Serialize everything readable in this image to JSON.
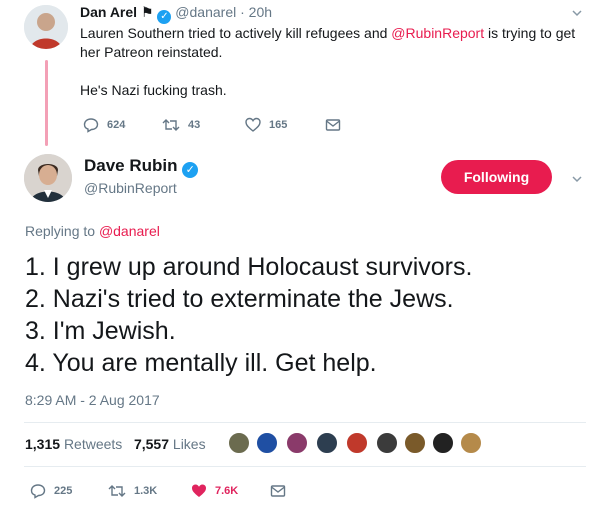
{
  "parent_tweet": {
    "author_name": "Dan Arel",
    "flag": "⚑",
    "handle": "@danarel",
    "separator": "·",
    "time": "20h",
    "text_a": "Lauren Southern tried to actively kill refugees and ",
    "mention": "@RubinReport",
    "text_b": " is trying to get",
    "text_line2": "her Patreon reinstated.",
    "text_line3": "He's Nazi fucking trash.",
    "replies": "624",
    "retweets": "43",
    "likes": "165"
  },
  "main_tweet": {
    "author_name": "Dave Rubin",
    "handle": "@RubinReport",
    "follow_label": "Following",
    "replying_prefix": "Replying to ",
    "replying_to": "@danarel",
    "lines": [
      "1. I grew up around Holocaust survivors.",
      "2. Nazi's tried to exterminate the Jews.",
      "3. I'm Jewish.",
      "4. You are mentally ill. Get help."
    ],
    "timestamp": "8:29 AM - 2 Aug 2017",
    "stats": {
      "retweets_count": "1,315",
      "retweets_label": "Retweets",
      "likes_count": "7,557",
      "likes_label": "Likes"
    },
    "actions": {
      "replies": "225",
      "retweets": "1.3K",
      "likes": "7.6K"
    }
  },
  "colors": {
    "accent": "#e81c4f",
    "verified": "#1da1f2",
    "muted": "#657786"
  },
  "icons": [
    "chevron-down-icon",
    "verified-icon",
    "reply-icon",
    "retweet-icon",
    "heart-icon",
    "envelope-icon",
    "flag-icon"
  ]
}
